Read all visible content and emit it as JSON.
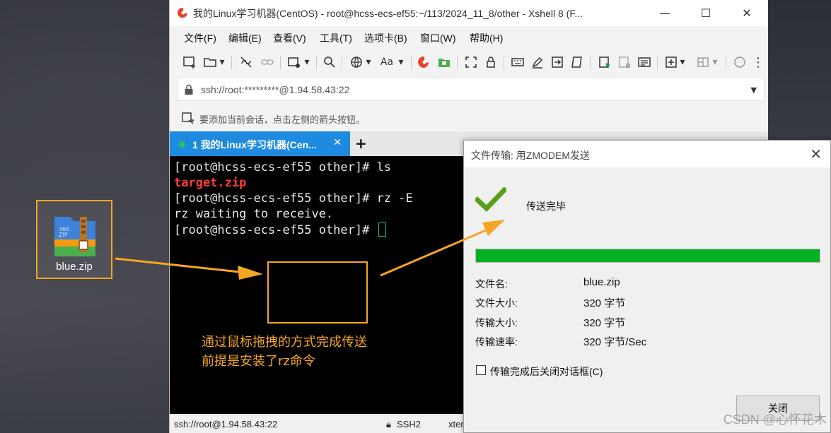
{
  "desktop": {
    "file_icon_label": "blue.zip"
  },
  "window": {
    "title": "我的Linux学习机器(CentOS) - root@hcss-ecs-ef55:~/113/2024_11_8/other - Xshell 8 (F...",
    "minimize_glyph": "—",
    "maximize_glyph": "☐",
    "close_glyph": "✕"
  },
  "menu": [
    "文件(F)",
    "编辑(E)",
    "查看(V)",
    "工具(T)",
    "选项卡(B)",
    "窗口(W)",
    "帮助(H)"
  ],
  "toolbar": {
    "font_button_label": "Aa"
  },
  "address_bar": {
    "value": "ssh://root:*********@1.94.58.43:22"
  },
  "session_hint": {
    "text": "要添加当前会话，点击左侧的箭头按钮。"
  },
  "tabs": [
    {
      "number": "1",
      "label": "我的Linux学习机器(Cen..."
    }
  ],
  "terminal": {
    "lines": [
      "[root@hcss-ecs-ef55 other]# ls",
      "target.zip",
      "[root@hcss-ecs-ef55 other]# rz -E",
      "rz waiting to receive.",
      "[root@hcss-ecs-ef55 other]# "
    ],
    "annotation_line1": "通过鼠标拖拽的方式完成传送",
    "annotation_line2": "前提是安装了rz命令"
  },
  "status_bar": {
    "connection": "ssh://root@1.94.58.43:22",
    "protocol": "SSH2",
    "terminal_type": "xter"
  },
  "dialog": {
    "title": "文件传输: 用ZMODEM发送",
    "status": "传送完毕",
    "progress": 1.0,
    "fields": [
      {
        "label": "文件名:",
        "value": "blue.zip"
      },
      {
        "label": "文件大小:",
        "value": "320 字节"
      },
      {
        "label": "传输大小:",
        "value": "320 字节"
      },
      {
        "label": "传输速率:",
        "value": "320 字节/Sec"
      }
    ],
    "checkbox_label": "传输完成后关闭对话框(C)",
    "checkbox_checked": false,
    "close_button": "关闭"
  },
  "watermark": "CSDN @心怀花木",
  "colors": {
    "annotation": "#f5a623",
    "tab_active": "#1e8ae0",
    "progress_fill": "#06b025",
    "terminal_highlight": "#ff3b3b",
    "cursor": "#22c55e"
  }
}
